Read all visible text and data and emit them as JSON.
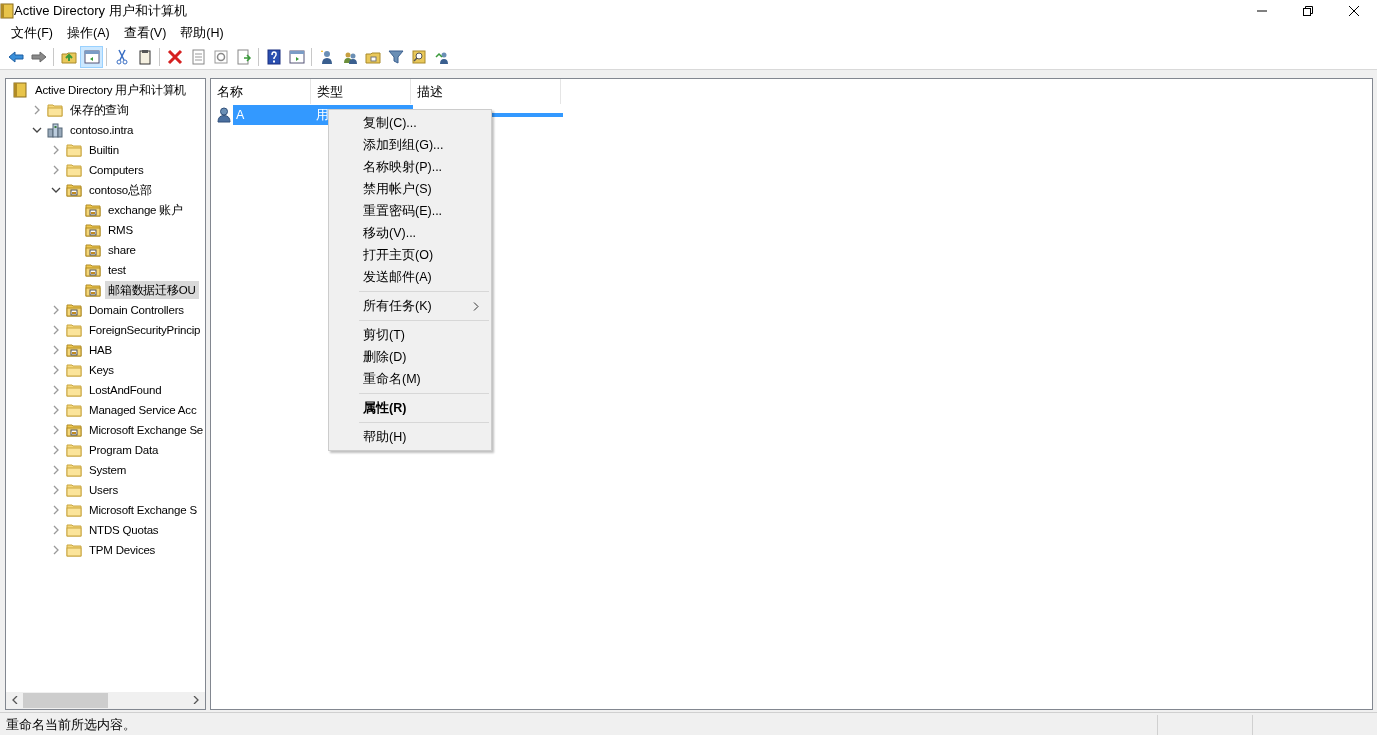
{
  "window": {
    "title": "Active Directory 用户和计算机"
  },
  "menu_bar": [
    "文件(F)",
    "操作(A)",
    "查看(V)",
    "帮助(H)"
  ],
  "toolbar": {
    "groups": [
      [
        {
          "pressed": false
        },
        {
          "pressed": false
        }
      ],
      [
        {
          "pressed": false
        },
        {
          "pressed": true
        }
      ],
      [
        {
          "pressed": false
        },
        {
          "pressed": false
        }
      ],
      [
        {
          "pressed": false
        },
        {
          "pressed": false
        },
        {
          "pressed": false
        },
        {
          "pressed": false
        }
      ],
      [
        {
          "pressed": false
        },
        {
          "pressed": false
        }
      ],
      [
        {
          "pressed": false
        },
        {
          "pressed": false
        },
        {
          "pressed": false
        },
        {
          "pressed": false
        },
        {
          "pressed": false
        },
        {
          "pressed": false
        }
      ]
    ]
  },
  "tree": [
    {
      "label": "Active Directory 用户和计算机",
      "kind": "console",
      "selected": false,
      "children": [
        {
          "label": "保存的查询",
          "kind": "folder",
          "expandable": true,
          "expanded": false,
          "selected": false
        },
        {
          "label": "contoso.intra",
          "kind": "domain",
          "expandable": true,
          "expanded": true,
          "selected": false,
          "children": [
            {
              "label": "Builtin",
              "kind": "folder",
              "expandable": true,
              "expanded": false,
              "selected": false
            },
            {
              "label": "Computers",
              "kind": "folder",
              "expandable": true,
              "expanded": false,
              "selected": false
            },
            {
              "label": "contoso总部",
              "kind": "ou",
              "expandable": true,
              "expanded": true,
              "selected": false,
              "children": [
                {
                  "label": "exchange 账户",
                  "kind": "ou",
                  "expandable": false,
                  "selected": false
                },
                {
                  "label": "RMS",
                  "kind": "ou",
                  "expandable": false,
                  "selected": false
                },
                {
                  "label": "share",
                  "kind": "ou",
                  "expandable": false,
                  "selected": false
                },
                {
                  "label": "test",
                  "kind": "ou",
                  "expandable": false,
                  "selected": false
                },
                {
                  "label": "邮箱数据迁移OU",
                  "kind": "ou",
                  "expandable": false,
                  "selected": true
                }
              ]
            },
            {
              "label": "Domain Controllers",
              "kind": "ou",
              "expandable": true,
              "expanded": false,
              "selected": false
            },
            {
              "label": "ForeignSecurityPrincip",
              "kind": "folder",
              "expandable": true,
              "expanded": false,
              "selected": false
            },
            {
              "label": "HAB",
              "kind": "ou",
              "expandable": true,
              "expanded": false,
              "selected": false
            },
            {
              "label": "Keys",
              "kind": "folder",
              "expandable": true,
              "expanded": false,
              "selected": false
            },
            {
              "label": "LostAndFound",
              "kind": "folder",
              "expandable": true,
              "expanded": false,
              "selected": false
            },
            {
              "label": "Managed Service Acc",
              "kind": "folder",
              "expandable": true,
              "expanded": false,
              "selected": false
            },
            {
              "label": "Microsoft Exchange Se",
              "kind": "ou",
              "expandable": true,
              "expanded": false,
              "selected": false
            },
            {
              "label": "Program Data",
              "kind": "folder",
              "expandable": true,
              "expanded": false,
              "selected": false
            },
            {
              "label": "System",
              "kind": "folder",
              "expandable": true,
              "expanded": false,
              "selected": false
            },
            {
              "label": "Users",
              "kind": "folder",
              "expandable": true,
              "expanded": false,
              "selected": false
            },
            {
              "label": "Microsoft Exchange S",
              "kind": "folder",
              "expandable": true,
              "expanded": false,
              "selected": false
            },
            {
              "label": "NTDS Quotas",
              "kind": "folder",
              "expandable": true,
              "expanded": false,
              "selected": false
            },
            {
              "label": "TPM Devices",
              "kind": "folder",
              "expandable": true,
              "expanded": false,
              "selected": false
            }
          ]
        }
      ]
    }
  ],
  "list": {
    "columns": [
      "名称",
      "类型",
      "描述"
    ],
    "rows": [
      {
        "cells": [
          "A",
          "用"
        ],
        "selected": true
      }
    ]
  },
  "context_menu": [
    {
      "kind": "item",
      "label": "复制(C)...",
      "default": false
    },
    {
      "kind": "item",
      "label": "添加到组(G)...",
      "default": false
    },
    {
      "kind": "item",
      "label": "名称映射(P)...",
      "default": false
    },
    {
      "kind": "item",
      "label": "禁用帐户(S)",
      "default": false
    },
    {
      "kind": "item",
      "label": "重置密码(E)...",
      "default": false
    },
    {
      "kind": "item",
      "label": "移动(V)...",
      "default": false
    },
    {
      "kind": "item",
      "label": "打开主页(O)",
      "default": false
    },
    {
      "kind": "item",
      "label": "发送邮件(A)",
      "default": false
    },
    {
      "kind": "separator"
    },
    {
      "kind": "submenu",
      "label": "所有任务(K)",
      "default": false
    },
    {
      "kind": "separator"
    },
    {
      "kind": "item",
      "label": "剪切(T)",
      "default": false
    },
    {
      "kind": "item",
      "label": "删除(D)",
      "default": false
    },
    {
      "kind": "item",
      "label": "重命名(M)",
      "default": false
    },
    {
      "kind": "separator"
    },
    {
      "kind": "item",
      "label": "属性(R)",
      "default": true
    },
    {
      "kind": "separator"
    },
    {
      "kind": "item",
      "label": "帮助(H)",
      "default": false
    }
  ],
  "status_bar": {
    "text": "重命名当前所选内容。"
  }
}
